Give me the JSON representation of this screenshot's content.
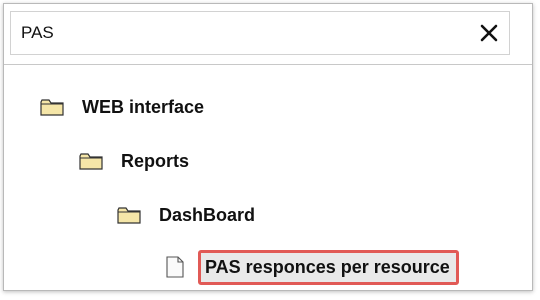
{
  "search": {
    "value": "PAS",
    "clear_icon": "close-icon"
  },
  "tree": {
    "items": [
      {
        "label": "WEB interface",
        "icon": "folder-icon",
        "level": 0
      },
      {
        "label": "Reports",
        "icon": "folder-icon",
        "level": 1
      },
      {
        "label": "DashBoard",
        "icon": "folder-icon",
        "level": 2
      },
      {
        "label": "PAS responces per resource",
        "icon": "file-icon",
        "level": 3,
        "highlighted": true
      }
    ]
  },
  "colors": {
    "highlight_border": "#e15a56",
    "folder_fill": "#f5e6a8",
    "folder_stroke": "#333333"
  }
}
